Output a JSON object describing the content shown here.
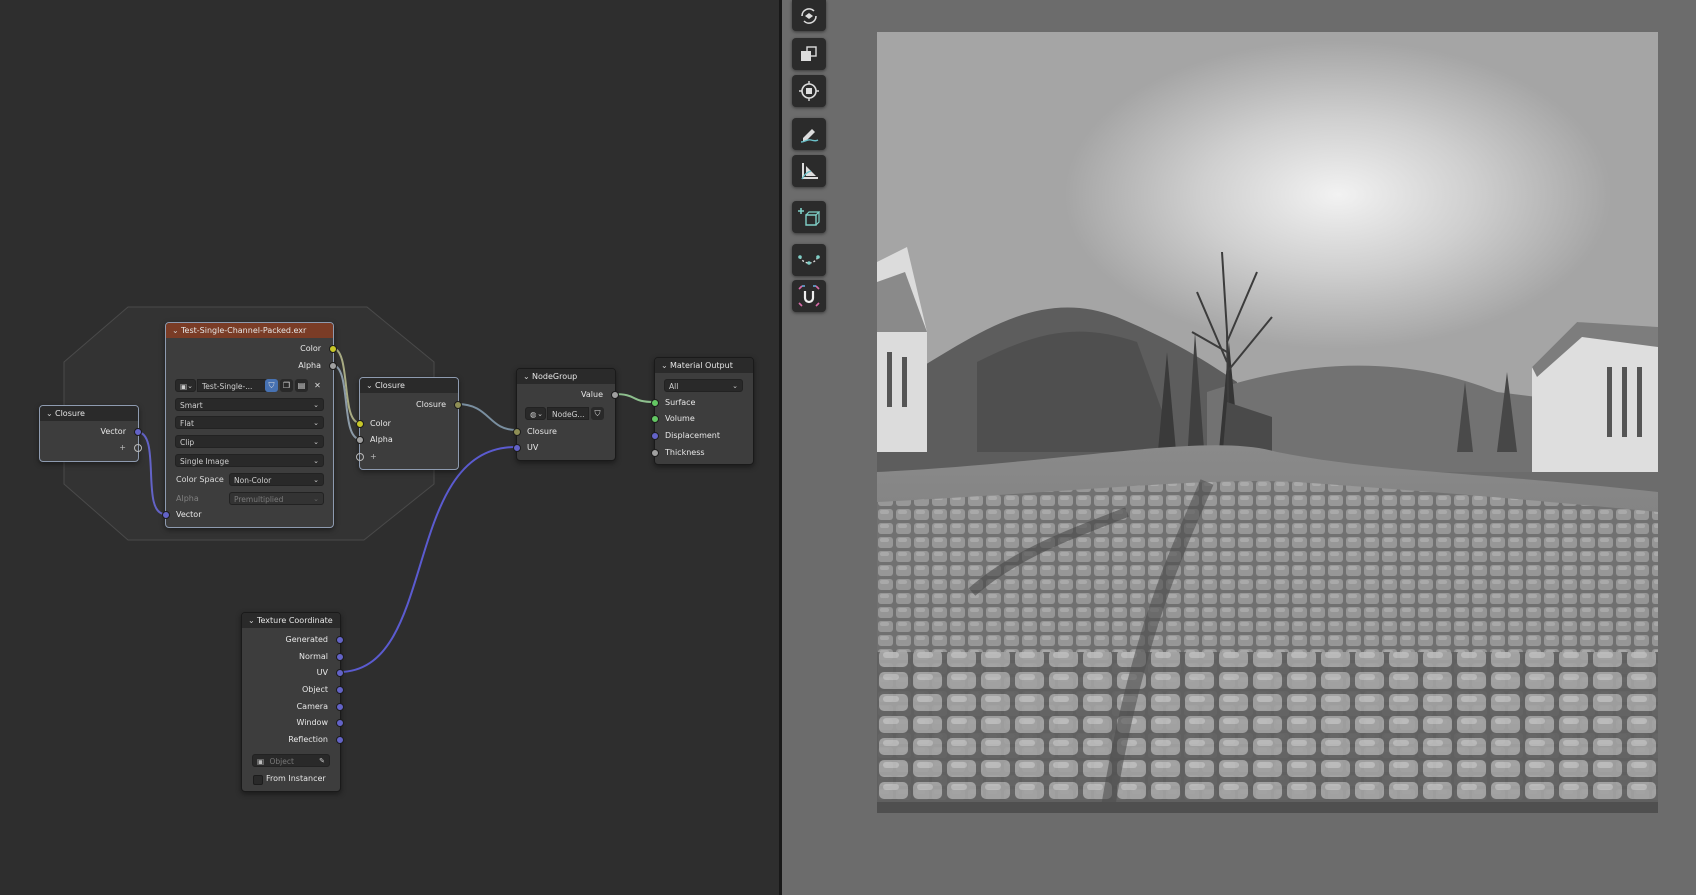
{
  "nodes": {
    "closure_left": {
      "title": "Closure",
      "output": "Vector",
      "add": "+"
    },
    "image": {
      "title": "Test-Single-Channel-Packed.exr",
      "outputs": [
        "Color",
        "Alpha"
      ],
      "image_name": "Test-Single-...",
      "interpolation": "Smart",
      "projection": "Flat",
      "extension": "Clip",
      "source": "Single Image",
      "color_space_label": "Color Space",
      "color_space": "Non-Color",
      "alpha_label": "Alpha",
      "alpha_mode": "Premultiplied",
      "input": "Vector"
    },
    "closure_mid": {
      "title": "Closure",
      "output": "Closure",
      "inputs": [
        "Color",
        "Alpha"
      ],
      "add": "+"
    },
    "nodegroup": {
      "title": "NodeGroup",
      "output": "Value",
      "group_name": "NodeG...",
      "inputs": [
        "Closure",
        "UV"
      ]
    },
    "material_output": {
      "title": "Material Output",
      "target": "All",
      "inputs": [
        "Surface",
        "Volume",
        "Displacement",
        "Thickness"
      ]
    },
    "texture_coordinate": {
      "title": "Texture Coordinate",
      "outputs": [
        "Generated",
        "Normal",
        "UV",
        "Object",
        "Camera",
        "Window",
        "Reflection"
      ],
      "object_placeholder": "Object",
      "from_instancer": "From Instancer"
    }
  },
  "toolbar": {
    "tools": [
      "rotate-view-icon",
      "scale-icon",
      "transform-icon",
      "annotate-icon",
      "measure-icon",
      "add-cube-icon",
      "curve-icon",
      "uv-icon"
    ]
  },
  "colors": {
    "socket_color": "#c7c729",
    "socket_float": "#a0a0a0",
    "socket_vector": "#6363c7",
    "socket_shader": "#63c763",
    "image_header": "#7a3c26"
  }
}
